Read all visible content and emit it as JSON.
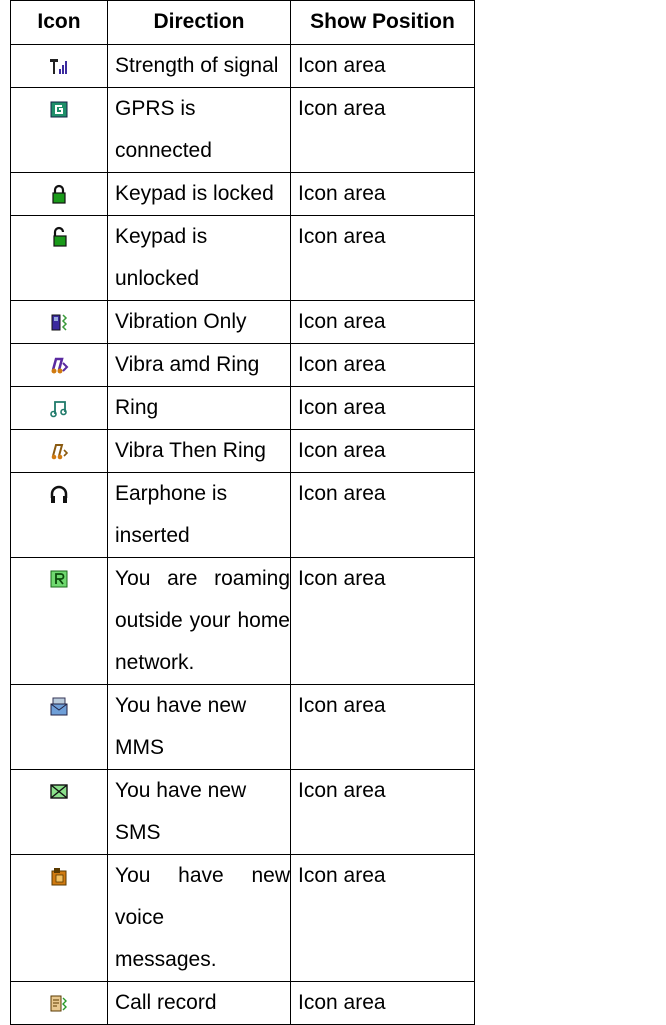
{
  "headers": {
    "icon": "Icon",
    "direction": "Direction",
    "position": "Show Position"
  },
  "rows": [
    {
      "icon": "signal-strength-icon",
      "direction": "Strength of signal",
      "position": "Icon area"
    },
    {
      "icon": "gprs-icon",
      "direction": "GPRS is connected",
      "position": "Icon area"
    },
    {
      "icon": "lock-icon",
      "direction": "Keypad is locked",
      "position": "Icon area"
    },
    {
      "icon": "unlock-icon",
      "direction": "Keypad is unlocked",
      "position": "Icon area"
    },
    {
      "icon": "vibration-icon",
      "direction": "Vibration Only",
      "position": "Icon area"
    },
    {
      "icon": "vibra-and-ring-icon",
      "direction": "Vibra amd Ring",
      "position": "Icon area"
    },
    {
      "icon": "ring-icon",
      "direction": "Ring",
      "position": "Icon area"
    },
    {
      "icon": "vibra-then-ring-icon",
      "direction": "Vibra Then Ring",
      "position": "Icon area"
    },
    {
      "icon": "earphone-icon",
      "direction": "Earphone is inserted",
      "position": "Icon area"
    },
    {
      "icon": "roaming-icon",
      "direction_lines": [
        "You are roaming",
        "outside your home",
        "network."
      ],
      "position": "Icon area"
    },
    {
      "icon": "mms-icon",
      "direction": "You have new MMS",
      "position": "Icon area"
    },
    {
      "icon": "sms-icon",
      "direction": "You have new SMS",
      "position": "Icon area"
    },
    {
      "icon": "voice-message-icon",
      "direction_lines": [
        "You have new voice",
        "messages."
      ],
      "position": "Icon area"
    },
    {
      "icon": "call-record-icon",
      "direction": "Call record",
      "position": "Icon area"
    }
  ],
  "colors": {
    "gprs": "#1f8f6a",
    "lock": "#1a9a1a",
    "purple": "#3b2a9e",
    "orange": "#d07a10",
    "envelope": "#6f9fd8",
    "green": "#2a9a2a"
  }
}
